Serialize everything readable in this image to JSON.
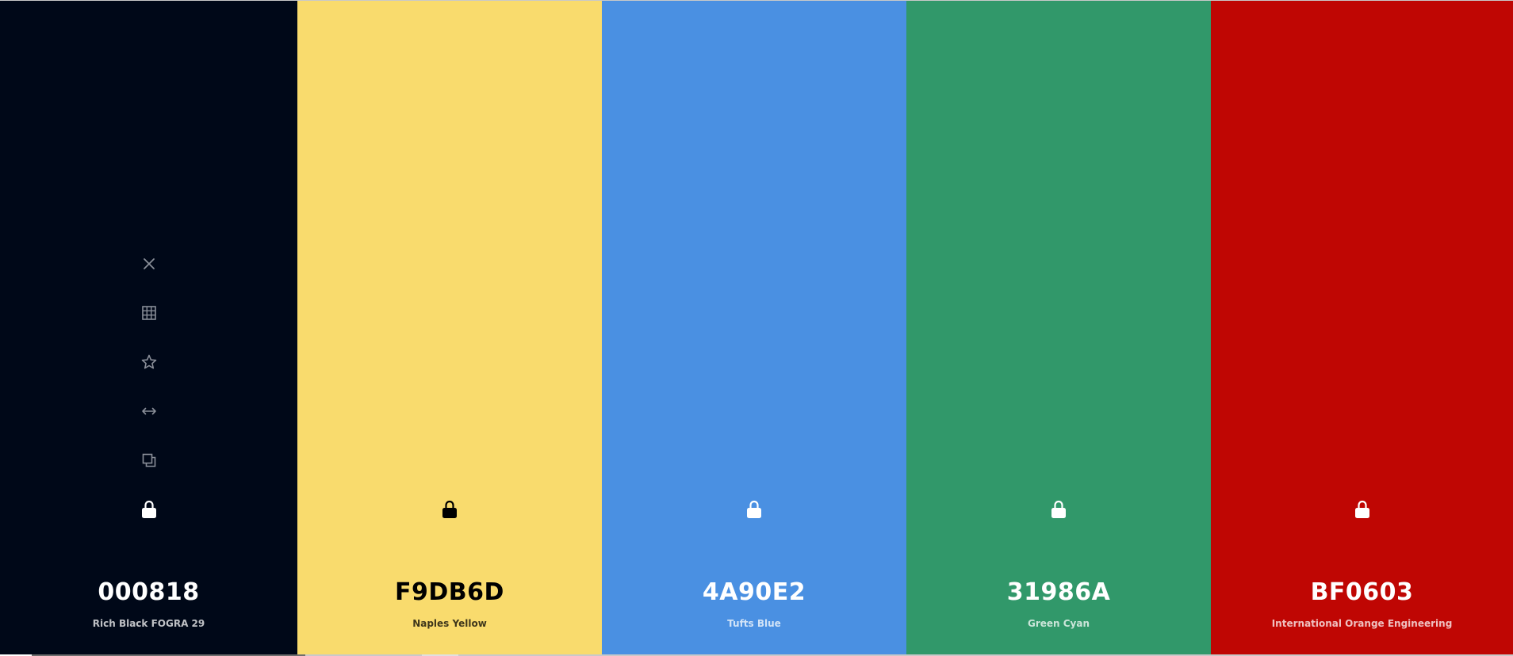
{
  "palette": [
    {
      "hex": "000818",
      "name": "Rich Black FOGRA 29",
      "bg": "#000818",
      "text": "#ffffff",
      "icon": "#8a8f99",
      "lock_icon": "lock-open-icon"
    },
    {
      "hex": "F9DB6D",
      "name": "Naples Yellow",
      "bg": "#F9DB6D",
      "text": "#000000",
      "icon": "#000000",
      "lock_icon": "lock-icon"
    },
    {
      "hex": "4A90E2",
      "name": "Tufts Blue",
      "bg": "#4A90E2",
      "text": "#ffffff",
      "icon": "#ffffff",
      "lock_icon": "lock-icon"
    },
    {
      "hex": "31986A",
      "name": "Green Cyan",
      "bg": "#31986A",
      "text": "#ffffff",
      "icon": "#ffffff",
      "lock_icon": "lock-icon"
    },
    {
      "hex": "BF0603",
      "name": "International Orange Engineering",
      "bg": "#BF0603",
      "text": "#ffffff",
      "icon": "#ffffff",
      "lock_icon": "lock-icon"
    }
  ],
  "tools": [
    {
      "icon": "close-icon",
      "action": "remove"
    },
    {
      "icon": "grid-icon",
      "action": "shades"
    },
    {
      "icon": "star-icon",
      "action": "favorite"
    },
    {
      "icon": "swap-horizontal-icon",
      "action": "drag"
    },
    {
      "icon": "copy-icon",
      "action": "copy"
    }
  ]
}
